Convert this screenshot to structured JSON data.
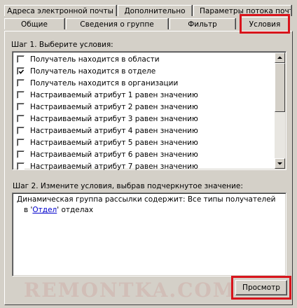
{
  "tabs_row1": [
    {
      "label": "Адреса электронной почты"
    },
    {
      "label": "Дополнительно"
    },
    {
      "label": "Параметры потока почты"
    }
  ],
  "tabs_row2": [
    {
      "label": "Общие"
    },
    {
      "label": "Сведения о группе"
    },
    {
      "label": "Фильтр"
    },
    {
      "label": "Условия",
      "active": true
    }
  ],
  "step1": {
    "label": "Шаг 1. Выберите условия:",
    "conditions": [
      {
        "label": "Получатель находится в области",
        "checked": false
      },
      {
        "label": "Получатель находится в отделе",
        "checked": true
      },
      {
        "label": "Получатель находится в организации",
        "checked": false
      },
      {
        "label": "Настраиваемый атрибут 1 равен значению",
        "checked": false
      },
      {
        "label": "Настраиваемый атрибут 2 равен значению",
        "checked": false
      },
      {
        "label": "Настраиваемый атрибут 3 равен значению",
        "checked": false
      },
      {
        "label": "Настраиваемый атрибут 4 равен значению",
        "checked": false
      },
      {
        "label": "Настраиваемый атрибут 5 равен значению",
        "checked": false
      },
      {
        "label": "Настраиваемый атрибут 6 равен значению",
        "checked": false
      },
      {
        "label": "Настраиваемый атрибут 7 равен значению",
        "checked": false
      }
    ]
  },
  "step2": {
    "label": "Шаг 2. Измените условия, выбрав подчеркнутое значение:",
    "line1": "Динамическая группа рассылки содержит: Все типы получателей",
    "line2_prefix": "в '",
    "line2_link": "Отдел",
    "line2_suffix": "' отделах"
  },
  "preview_button": "Просмотр",
  "watermark": "REMONTKA.COM",
  "colors": {
    "highlight": "#d8141c",
    "link": "#0000cc",
    "face": "#d4d0c8"
  }
}
